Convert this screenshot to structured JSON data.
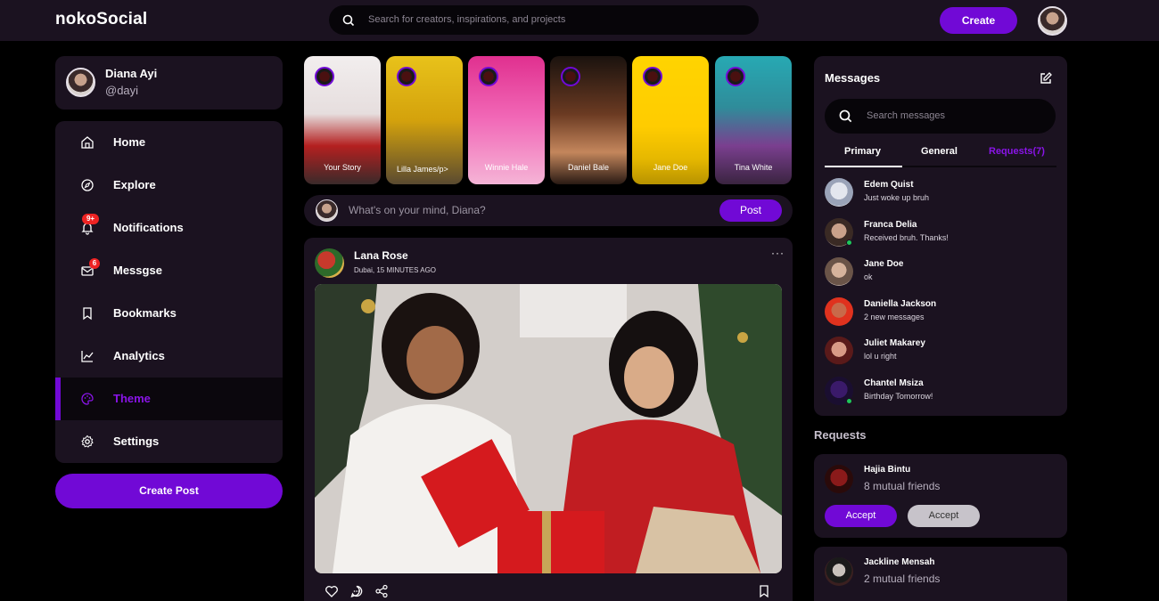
{
  "header": {
    "logo": "nokoSocial",
    "search_placeholder": "Search for creators, inspirations, and projects",
    "create_label": "Create"
  },
  "profile": {
    "name": "Diana Ayi",
    "handle": "@dayi"
  },
  "sidebar": {
    "items": [
      {
        "label": "Home",
        "icon": "home-icon"
      },
      {
        "label": "Explore",
        "icon": "compass-icon"
      },
      {
        "label": "Notifications",
        "icon": "bell-icon",
        "badge": "9+"
      },
      {
        "label": "Messgse",
        "icon": "envelope-icon",
        "badge": "6"
      },
      {
        "label": "Bookmarks",
        "icon": "bookmark-icon"
      },
      {
        "label": "Analytics",
        "icon": "chart-line-icon"
      },
      {
        "label": "Theme",
        "icon": "palette-icon",
        "active": true
      },
      {
        "label": "Settings",
        "icon": "gear-icon"
      }
    ],
    "create_post_label": "Create Post"
  },
  "stories": [
    {
      "label": "Your Story"
    },
    {
      "label": "Lilla James/p>"
    },
    {
      "label": "Winnie Hale"
    },
    {
      "label": "Daniel Bale"
    },
    {
      "label": "Jane Doe"
    },
    {
      "label": "Tina White"
    }
  ],
  "composer": {
    "placeholder": "What's on your mind, Diana?",
    "post_label": "Post"
  },
  "feed": {
    "post": {
      "author": "Lana Rose",
      "meta": "Dubai, 15 MINUTES AGO",
      "more": "···"
    }
  },
  "messages": {
    "title": "Messages",
    "search_placeholder": "Search messages",
    "tabs": [
      "Primary",
      "General",
      "Requests(7)"
    ],
    "list": [
      {
        "name": "Edem Quist",
        "text": "Just woke up bruh"
      },
      {
        "name": "Franca Delia",
        "text": "Received bruh. Thanks!",
        "online": true
      },
      {
        "name": "Jane Doe",
        "text": "ok"
      },
      {
        "name": "Daniella Jackson",
        "text": "2 new messages"
      },
      {
        "name": "Juliet Makarey",
        "text": "lol u right"
      },
      {
        "name": "Chantel Msiza",
        "text": "Birthday Tomorrow!",
        "online": true
      }
    ]
  },
  "requests": {
    "heading": "Requests",
    "items": [
      {
        "name": "Hajia Bintu",
        "mutual": "8 mutual friends",
        "accept": "Accept",
        "decline": "Accept"
      },
      {
        "name": "Jackline Mensah",
        "mutual": "2 mutual friends"
      }
    ]
  },
  "colors": {
    "accent": "#7109d6",
    "surface": "#1b1220",
    "background": "#000000",
    "badge": "#ee2323",
    "online": "#1ec75a"
  }
}
